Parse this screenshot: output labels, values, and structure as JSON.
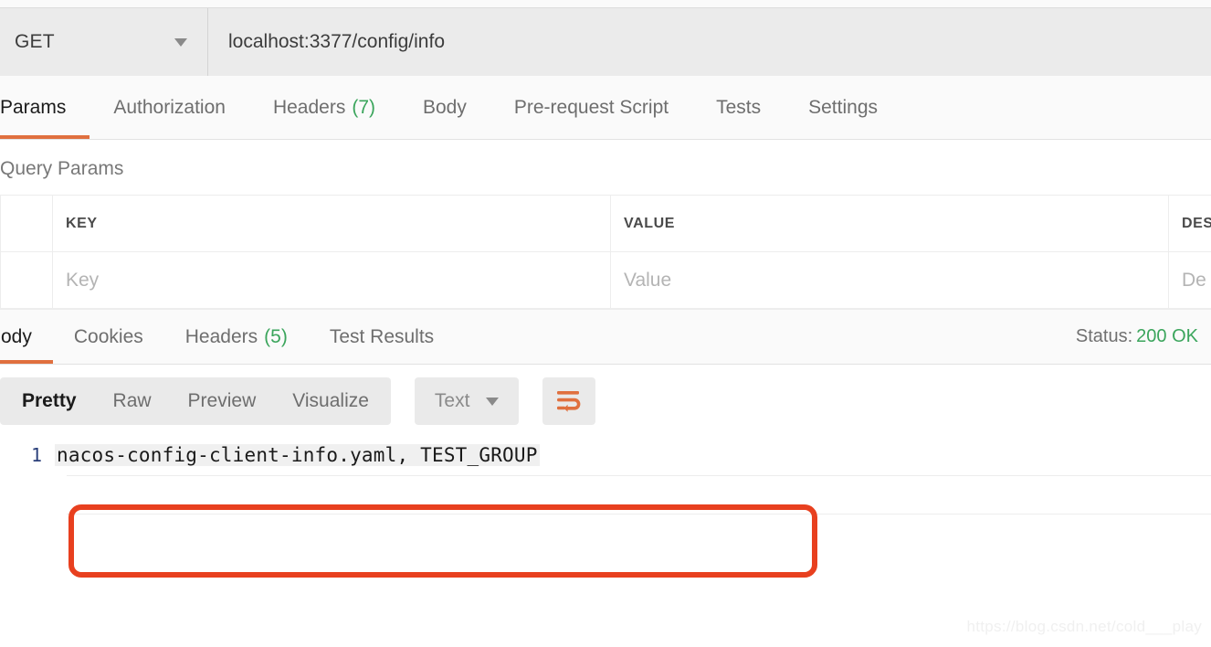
{
  "request": {
    "method": "GET",
    "url": "localhost:3377/config/info",
    "method_caret_icon": "chevron-down-icon",
    "tabs": [
      {
        "label": "Params",
        "count": "",
        "active": true
      },
      {
        "label": "Authorization",
        "count": "",
        "active": false
      },
      {
        "label": "Headers",
        "count": "(7)",
        "active": false
      },
      {
        "label": "Body",
        "count": "",
        "active": false
      },
      {
        "label": "Pre-request Script",
        "count": "",
        "active": false
      },
      {
        "label": "Tests",
        "count": "",
        "active": false
      },
      {
        "label": "Settings",
        "count": "",
        "active": false
      }
    ]
  },
  "query_params": {
    "section_title": "Query Params",
    "columns": [
      "",
      "KEY",
      "VALUE",
      "DESCRIPTION"
    ],
    "column_desc_truncated": "DES",
    "rows": [
      {
        "checked": false,
        "key_placeholder": "Key",
        "value_placeholder": "Value",
        "description_placeholder": "Description",
        "description_placeholder_truncated": "De"
      }
    ]
  },
  "response": {
    "tabs": [
      {
        "label": "Body",
        "count": "",
        "active": true
      },
      {
        "label": "Cookies",
        "count": "",
        "active": false
      },
      {
        "label": "Headers",
        "count": "(5)",
        "active": false
      },
      {
        "label": "Test Results",
        "count": "",
        "active": false
      }
    ],
    "status_label": "Status:",
    "status_value": "200 OK",
    "status_color": "#3ba55c",
    "view_modes": [
      {
        "label": "Pretty",
        "active": true
      },
      {
        "label": "Raw",
        "active": false
      },
      {
        "label": "Preview",
        "active": false
      },
      {
        "label": "Visualize",
        "active": false
      }
    ],
    "format_selected": "Text",
    "format_caret_icon": "chevron-down-icon",
    "wrap_button_icon": "word-wrap-icon",
    "wrap_button_color": "#e0703f",
    "body_lines": [
      {
        "number": "1",
        "text": "nacos-config-client-info.yaml, TEST_GROUP"
      }
    ]
  },
  "annotation": {
    "highlight_color": "#e8401f"
  },
  "watermark": {
    "text": "https://blog.csdn.net/cold___play"
  },
  "theme": {
    "accent": "#e0703f",
    "green": "#3ba55c",
    "bar_bg": "#ebebeb",
    "tab_bg": "#fafafa"
  }
}
